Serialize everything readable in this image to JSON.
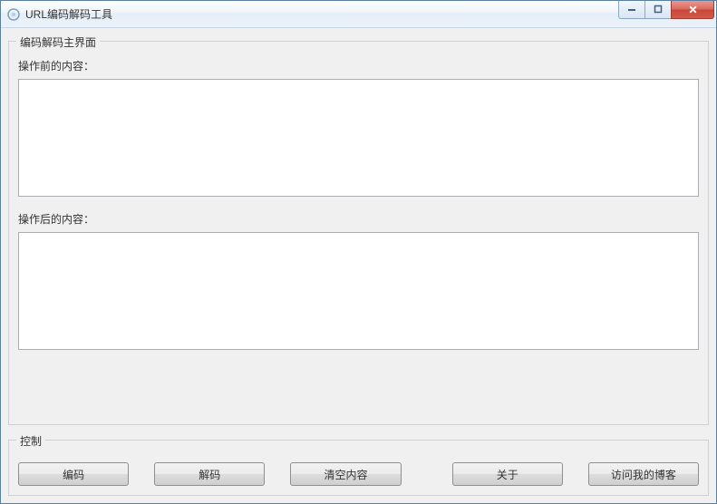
{
  "window": {
    "title": "URL编码解码工具"
  },
  "main_group": {
    "title": "编码解码主界面",
    "before_label": "操作前的内容：",
    "before_value": "",
    "after_label": "操作后的内容：",
    "after_value": ""
  },
  "control_group": {
    "title": "控制",
    "buttons": {
      "encode": "编码",
      "decode": "解码",
      "clear": "清空内容",
      "about": "关于",
      "blog": "访问我的博客"
    }
  }
}
